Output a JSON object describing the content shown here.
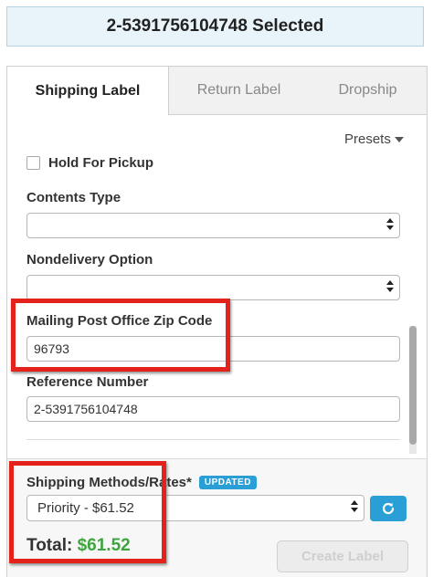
{
  "banner": {
    "text": "2-5391756104748 Selected"
  },
  "tabs": [
    {
      "label": "Shipping Label",
      "active": true
    },
    {
      "label": "Return Label",
      "active": false
    },
    {
      "label": "Dropship",
      "active": false
    }
  ],
  "presets": {
    "label": "Presets"
  },
  "hold_for_pickup": {
    "label": "Hold For Pickup",
    "checked": false
  },
  "contents_type": {
    "label": "Contents Type",
    "value": ""
  },
  "nondelivery_option": {
    "label": "Nondelivery Option",
    "value": ""
  },
  "mailing_zip": {
    "label": "Mailing Post Office Zip Code",
    "value": "96793"
  },
  "reference_number": {
    "label": "Reference Number",
    "value": "2-5391756104748"
  },
  "shipping_methods": {
    "label": "Shipping Methods/Rates*",
    "badge": "UPDATED",
    "selected": "Priority - $61.52"
  },
  "total": {
    "label": "Total:",
    "amount": "$61.52"
  },
  "create_button": {
    "label": "Create Label"
  },
  "colors": {
    "accent": "#2a9fd6",
    "highlight": "#e3231b",
    "total_green": "#3da53d"
  }
}
